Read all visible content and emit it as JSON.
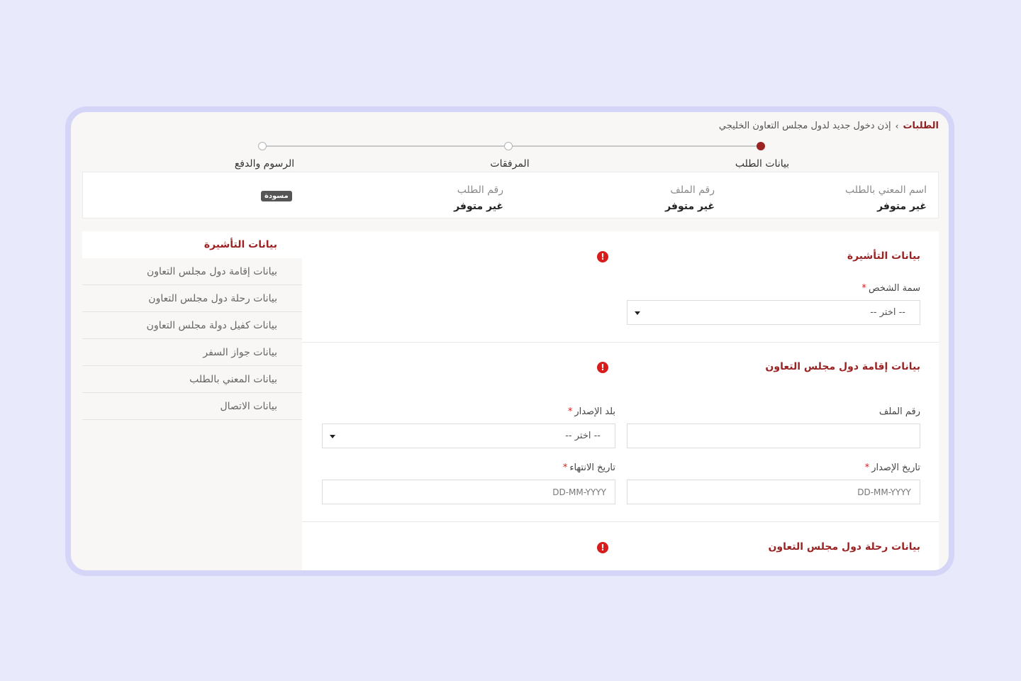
{
  "breadcrumb": {
    "root": "الطلبات",
    "separator": "›",
    "current": "إذن دخول جديد لدول مجلس التعاون الخليجي"
  },
  "steps": [
    {
      "label": "بيانات الطلب",
      "state": "active"
    },
    {
      "label": "المرفقات",
      "state": "pending"
    },
    {
      "label": "الرسوم والدفع",
      "state": "pending"
    }
  ],
  "summary": {
    "applicant": {
      "label": "اسم المعني بالطلب",
      "value": "غير متوفر"
    },
    "file_no": {
      "label": "رقم الملف",
      "value": "غير متوفر"
    },
    "request_no": {
      "label": "رقم الطلب",
      "value": "غير متوفر"
    },
    "status_badge": "مسودة"
  },
  "sidenav": {
    "items": [
      {
        "label": "بيانات التأشيرة",
        "active": true
      },
      {
        "label": "بيانات إقامة دول مجلس التعاون"
      },
      {
        "label": "بيانات رحلة دول مجلس التعاون"
      },
      {
        "label": "بيانات كفيل دولة مجلس التعاون"
      },
      {
        "label": "بيانات جواز السفر"
      },
      {
        "label": "بيانات المعني بالطلب"
      },
      {
        "label": "بيانات الاتصال"
      }
    ]
  },
  "sections": {
    "visa": {
      "title": "بيانات التأشيرة",
      "person_attr": {
        "label": "سمة الشخص",
        "value": "-- اختر --"
      }
    },
    "residence": {
      "title": "بيانات إقامة دول مجلس التعاون",
      "file_no": {
        "label": "رقم الملف",
        "value": ""
      },
      "issue_country": {
        "label": "بلد الإصدار",
        "value": "-- اختر --"
      },
      "issue_date": {
        "label": "تاريخ الإصدار",
        "placeholder": "DD-MM-YYYY"
      },
      "expiry_date": {
        "label": "تاريخ الانتهاء",
        "placeholder": "DD-MM-YYYY"
      }
    },
    "trip": {
      "title": "بيانات رحلة دول مجلس التعاون"
    }
  },
  "colors": {
    "accent": "#9b2323",
    "warning": "#d81c1c",
    "page_bg": "#e9e9fc",
    "frame_border": "#d5d6f7"
  },
  "icons": {
    "warning": "exclamation-circle-icon",
    "select": "caret-down-icon"
  }
}
